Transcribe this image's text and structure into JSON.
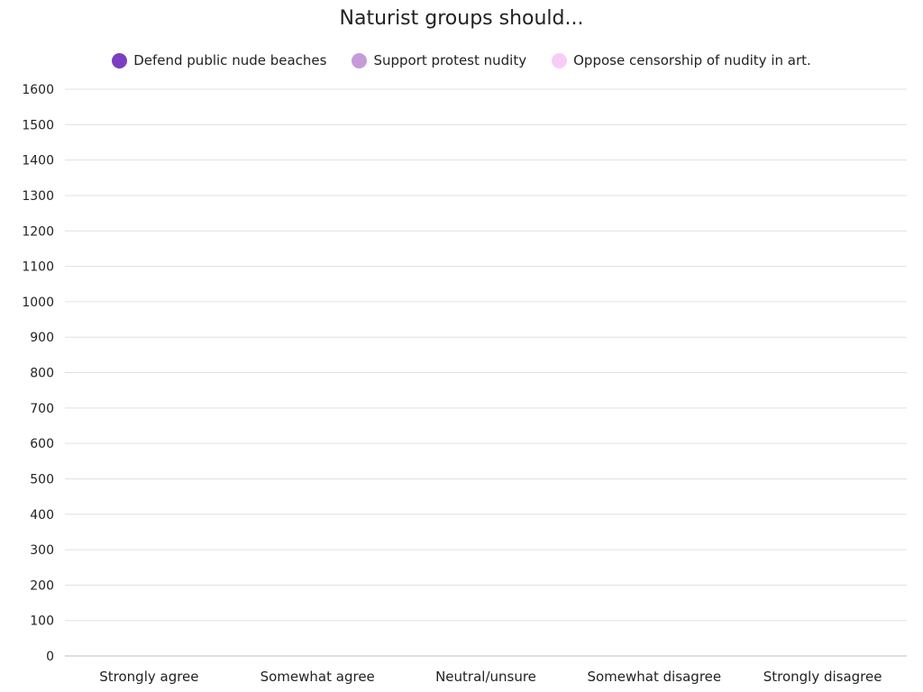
{
  "chart_data": {
    "type": "bar",
    "title": "Naturist groups should...",
    "categories": [
      "Strongly agree",
      "Somewhat agree",
      "Neutral/unsure",
      "Somewhat disagree",
      "Strongly disagree"
    ],
    "series": [
      {
        "name": "Defend public nude beaches",
        "color": "#7b3fbf",
        "values": [
          0,
          0,
          0,
          0,
          0
        ]
      },
      {
        "name": "Support protest nudity",
        "color": "#c79bd8",
        "values": [
          0,
          0,
          0,
          0,
          0
        ]
      },
      {
        "name": "Oppose censorship of nudity in art.",
        "color": "#f7cdf7",
        "values": [
          0,
          0,
          0,
          0,
          0
        ]
      }
    ],
    "ylim": [
      0,
      1600
    ],
    "yticks": [
      0,
      100,
      200,
      300,
      400,
      500,
      600,
      700,
      800,
      900,
      1000,
      1100,
      1200,
      1300,
      1400,
      1500,
      1600
    ],
    "grid": true,
    "legend_position": "top-center",
    "xlabel": "",
    "ylabel": ""
  }
}
